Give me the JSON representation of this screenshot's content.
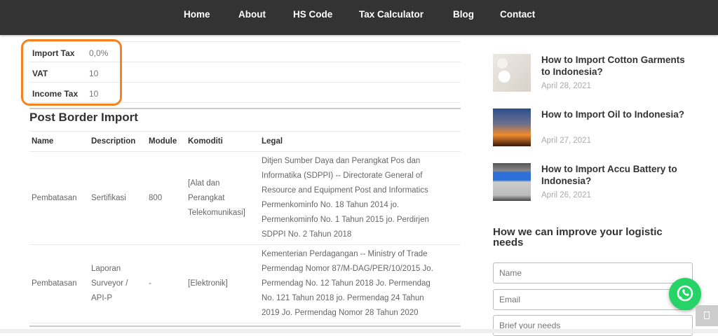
{
  "nav": {
    "items": [
      "Home",
      "About",
      "HS Code",
      "Tax Calculator",
      "Blog",
      "Contact"
    ]
  },
  "taxes": [
    {
      "label": "Import Tax",
      "value": "0,0%"
    },
    {
      "label": "VAT",
      "value": "10"
    },
    {
      "label": "Income Tax",
      "value": "10"
    }
  ],
  "section_title": "Post Border Import",
  "table": {
    "headers": [
      "Name",
      "Description",
      "Module",
      "Komoditi",
      "Legal"
    ],
    "rows": [
      {
        "name": "Pembatasan",
        "description": [
          "Sertifikasi"
        ],
        "module": "800",
        "komoditi": [
          "[Alat dan",
          "Perangkat",
          "Telekomunikasi]"
        ],
        "legal": [
          "Ditjen Sumber Daya dan Perangkat Pos dan",
          "Informatika (SDPPI) -- Directorate General of",
          "Resource and Equipment Post and Informatics",
          "Permenkominfo No. 18 Tahun 2014 jo.",
          "Permenkominfo No. 1 Tahun 2015 jo. Perdirjen",
          "SDPPI No. 2 Tahun 2018"
        ]
      },
      {
        "name": "Pembatasan",
        "description": [
          "Laporan",
          "Surveyor /",
          "API-P"
        ],
        "module": "-",
        "komoditi": [
          "[Elektronik]"
        ],
        "legal": [
          "Kementerian Perdagangan -- Ministry of Trade",
          "Permendag Nomor 87/M-DAG/PER/10/2015 Jo.",
          "Permendag No. 12 Tahun 2018 Jo. Permendag",
          "No. 121 Tahun 2018 jo. Permendag 24 Tahun",
          "2019 Jo. Permendag Nomor 28 Tahun 2020"
        ]
      }
    ]
  },
  "posts": [
    {
      "title": "How to Import Cotton Garments to Indonesia?",
      "date": "April 28, 2021"
    },
    {
      "title": "How to Import Oil to Indonesia?",
      "date": "April 27, 2021"
    },
    {
      "title": "How to Import Accu Battery to Indonesia?",
      "date": "April 26, 2021"
    }
  ],
  "form": {
    "title": "How we can improve your logistic needs",
    "name_placeholder": "Name",
    "email_placeholder": "Email",
    "needs_placeholder": "Brief your needs"
  },
  "colors": {
    "nav": "#333333",
    "highlight": "#f58220",
    "whatsapp": "#25d366"
  }
}
